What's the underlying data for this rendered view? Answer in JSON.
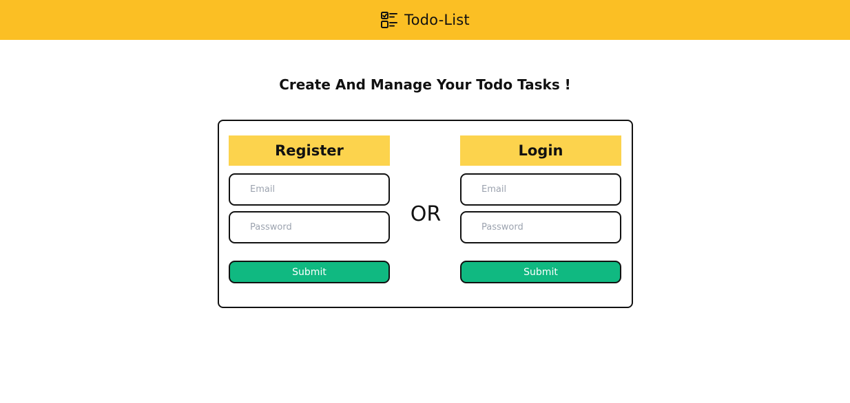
{
  "header": {
    "title": "Todo-List",
    "icon": "checklist-icon",
    "background_color": "#fbbf24"
  },
  "main": {
    "headline": "Create And Manage Your Todo Tasks !",
    "divider_text": "OR"
  },
  "register": {
    "title": "Register",
    "email_placeholder": "Email",
    "email_value": "",
    "password_placeholder": "Password",
    "password_value": "",
    "submit_label": "Submit"
  },
  "login": {
    "title": "Login",
    "email_placeholder": "Email",
    "email_value": "",
    "password_placeholder": "Password",
    "password_value": "",
    "submit_label": "Submit"
  },
  "colors": {
    "panel_header": "#fcd34d",
    "submit_button": "#10b981",
    "border": "#111111"
  }
}
